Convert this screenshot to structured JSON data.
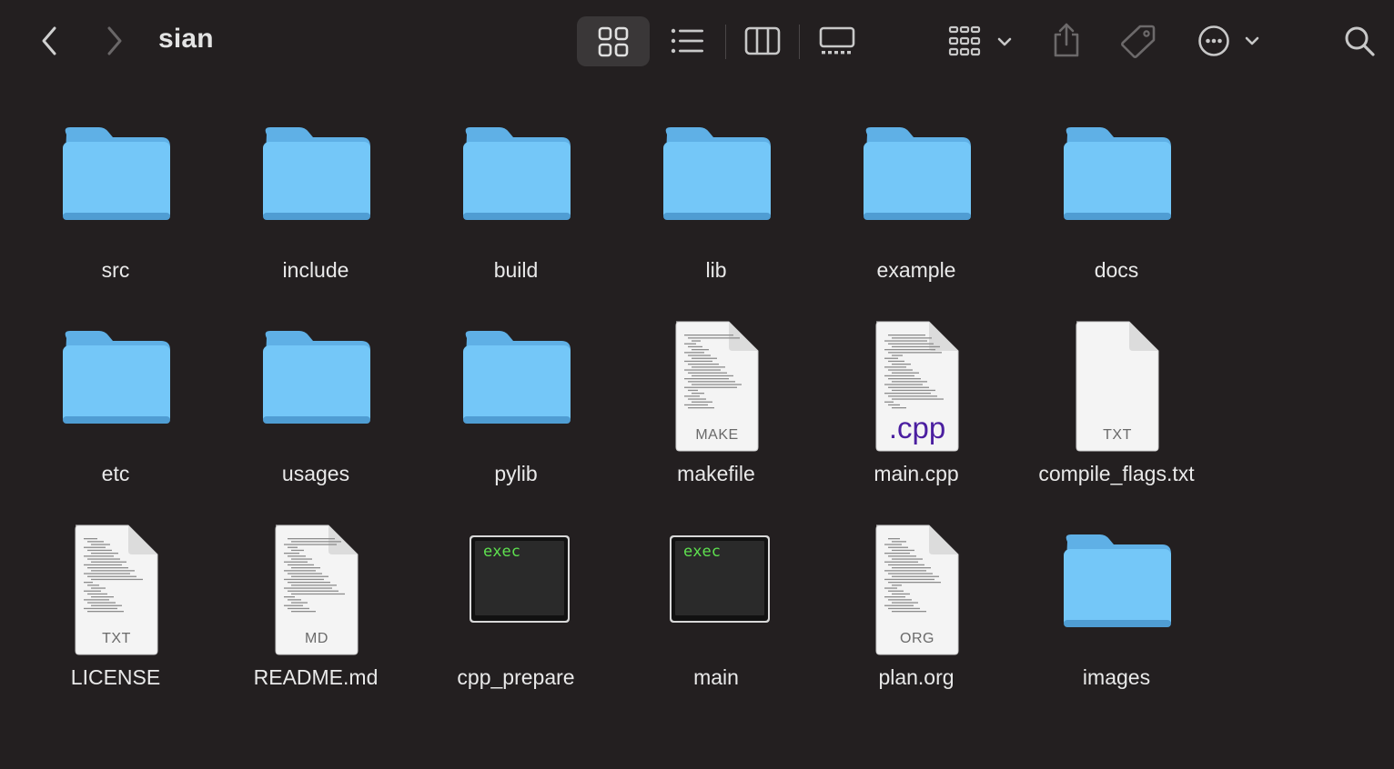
{
  "window": {
    "title": "sian"
  },
  "toolbar": {
    "back": "chevron-left-icon",
    "forward": "chevron-right-icon",
    "view_icons": "grid-view-icon",
    "view_list": "list-view-icon",
    "view_columns": "column-view-icon",
    "view_gallery": "gallery-view-icon",
    "group": "group-by-icon",
    "share": "share-icon",
    "tags": "tag-icon",
    "more": "ellipsis-circle-icon",
    "search": "search-icon"
  },
  "colors": {
    "background": "#231f20",
    "folder": "#74c7f8",
    "folder_tab": "#5fb0e6",
    "cpp_badge": "#4b1fa0",
    "exec_green": "#5ee04f"
  },
  "items": [
    {
      "name": "src",
      "kind": "folder"
    },
    {
      "name": "include",
      "kind": "folder"
    },
    {
      "name": "build",
      "kind": "folder"
    },
    {
      "name": "lib",
      "kind": "folder"
    },
    {
      "name": "example",
      "kind": "folder"
    },
    {
      "name": "docs",
      "kind": "folder"
    },
    {
      "name": "etc",
      "kind": "folder"
    },
    {
      "name": "usages",
      "kind": "folder"
    },
    {
      "name": "pylib",
      "kind": "folder"
    },
    {
      "name": "makefile",
      "kind": "doc",
      "badge": "MAKE"
    },
    {
      "name": "main.cpp",
      "kind": "cpp",
      "badge": ".cpp"
    },
    {
      "name": "compile_flags.txt",
      "kind": "doc-blank",
      "badge": "TXT"
    },
    {
      "name": "LICENSE",
      "kind": "doc",
      "badge": "TXT"
    },
    {
      "name": "README.md",
      "kind": "doc",
      "badge": "MD"
    },
    {
      "name": "cpp_prepare",
      "kind": "exec",
      "badge": "exec"
    },
    {
      "name": "main",
      "kind": "exec",
      "badge": "exec"
    },
    {
      "name": "plan.org",
      "kind": "doc",
      "badge": "ORG"
    },
    {
      "name": "images",
      "kind": "folder"
    }
  ]
}
